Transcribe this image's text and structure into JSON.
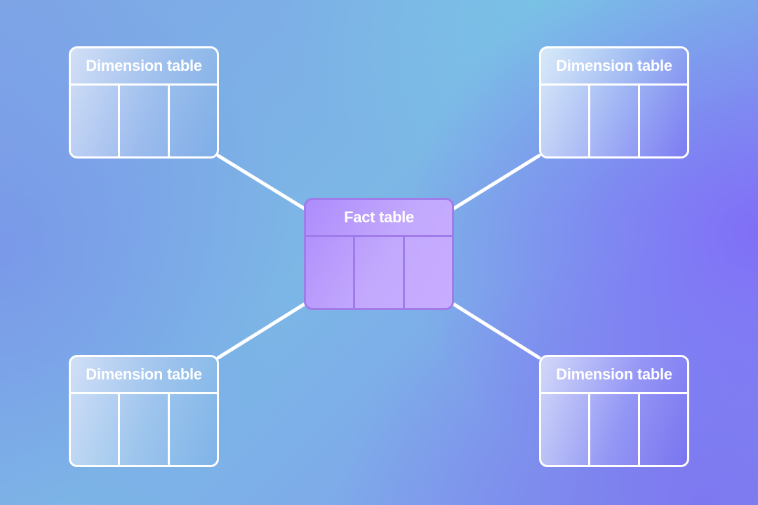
{
  "diagram": {
    "type": "star-schema",
    "fact_table": {
      "label": "Fact table",
      "columns": 3,
      "fill_color": "#b99bfc",
      "border_color": "#a07cea"
    },
    "dimension_tables": [
      {
        "position": "top-left",
        "label": "Dimension table",
        "columns": 3
      },
      {
        "position": "top-right",
        "label": "Dimension table",
        "columns": 3
      },
      {
        "position": "bottom-left",
        "label": "Dimension table",
        "columns": 3
      },
      {
        "position": "bottom-right",
        "label": "Dimension table",
        "columns": 3
      }
    ],
    "connections": [
      {
        "from": "fact_table",
        "to": "top-left"
      },
      {
        "from": "fact_table",
        "to": "top-right"
      },
      {
        "from": "fact_table",
        "to": "bottom-left"
      },
      {
        "from": "fact_table",
        "to": "bottom-right"
      }
    ],
    "colors": {
      "line": "#ffffff",
      "background_primary": "#7cb7e6",
      "background_accent": "#806cf8"
    }
  }
}
